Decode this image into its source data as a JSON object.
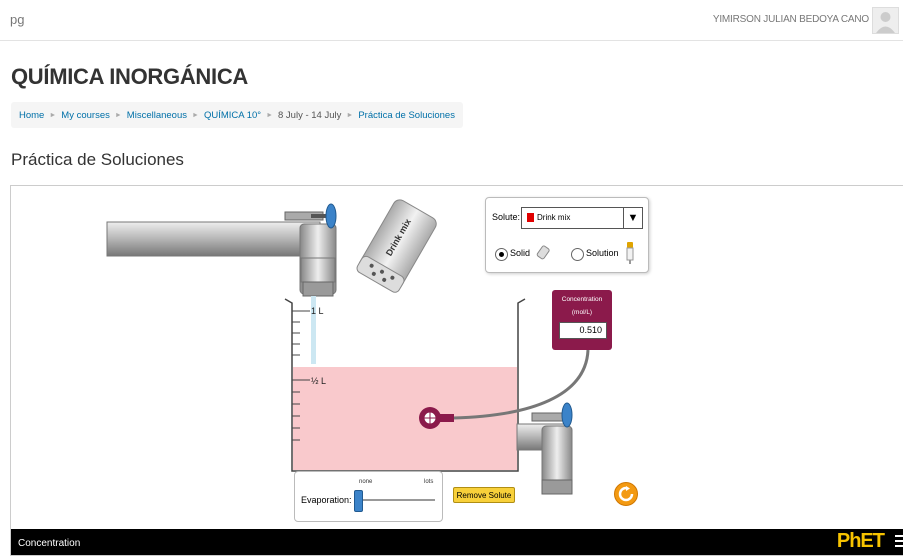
{
  "site": {
    "brand": "pg",
    "user_name": "YIMIRSON JULIAN BEDOYA CANO"
  },
  "course_heading": "QUÍMICA INORGÁNICA",
  "breadcrumb": [
    {
      "label": "Home"
    },
    {
      "label": "My courses"
    },
    {
      "label": "Miscellaneous"
    },
    {
      "label": "QUÍMICA 10°"
    },
    {
      "label": "8 July - 14 July"
    },
    {
      "label": "Práctica de Soluciones"
    }
  ],
  "page_title": "Práctica de Soluciones",
  "simulation": {
    "name": "Concentration",
    "brand": "PhET",
    "shaker_label": "Drink mix",
    "beaker_marks": {
      "full": "1 L",
      "half": "½ L"
    },
    "solute": {
      "label": "Solute:",
      "selected": "Drink mix",
      "swatch_color": "#e00000",
      "form_solid": "Solid",
      "form_solution": "Solution",
      "selected_form": "Solid"
    },
    "meter": {
      "title": "Concentration",
      "unit": "(mol/L)",
      "value": "0.510"
    },
    "evaporation": {
      "label": "Evaporation:",
      "min_label": "none",
      "max_label": "lots",
      "level": 0
    },
    "remove_solute_label": "Remove Solute",
    "solution_color": "#f9c9cc",
    "solution_level_fraction": 0.5
  }
}
